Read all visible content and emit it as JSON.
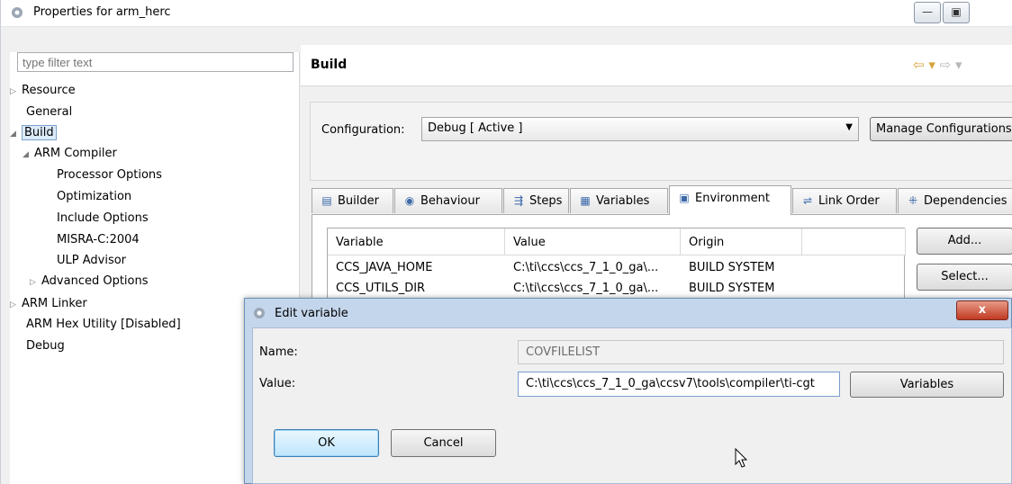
{
  "window": {
    "title": "Properties for arm_herc",
    "minimize_glyph": "—",
    "maximize_glyph": "▣"
  },
  "left": {
    "filter_placeholder": "type filter text",
    "tree": [
      {
        "label": "Resource",
        "arrow": "▷"
      },
      {
        "label": "General",
        "arrow": ""
      },
      {
        "label": "Build",
        "arrow": "◢",
        "selected": true
      },
      {
        "label": "ARM Compiler",
        "arrow": "◢"
      },
      {
        "label": "Processor Options",
        "arrow": ""
      },
      {
        "label": "Optimization",
        "arrow": ""
      },
      {
        "label": "Include Options",
        "arrow": ""
      },
      {
        "label": "MISRA-C:2004",
        "arrow": ""
      },
      {
        "label": "ULP Advisor",
        "arrow": ""
      },
      {
        "label": "Advanced Options",
        "arrow": "▷"
      },
      {
        "label": "ARM Linker",
        "arrow": "▷"
      },
      {
        "label": "ARM Hex Utility  [Disabled]",
        "arrow": ""
      },
      {
        "label": "Debug",
        "arrow": ""
      }
    ]
  },
  "build": {
    "heading": "Build",
    "nav_back": "⇦ ▾",
    "nav_forward": "⇨ ▾",
    "config_label": "Configuration:",
    "config_value": "Debug  [ Active ]",
    "manage_button": "Manage Configurations...",
    "tabs": [
      {
        "label": "Builder",
        "icon": "▤"
      },
      {
        "label": "Behaviour",
        "icon": "◉"
      },
      {
        "label": "Steps",
        "icon": "⇶"
      },
      {
        "label": "Variables",
        "icon": "▦"
      },
      {
        "label": "Environment",
        "icon": "▣",
        "active": true
      },
      {
        "label": "Link Order",
        "icon": "⇌"
      },
      {
        "label": "Dependencies",
        "icon": "⁜"
      }
    ],
    "table": {
      "headers": [
        "Variable",
        "Value",
        "Origin"
      ],
      "rows": [
        [
          "CCS_JAVA_HOME",
          "C:\\ti\\ccs\\ccs_7_1_0_ga\\...",
          "BUILD SYSTEM"
        ],
        [
          "CCS_UTILS_DIR",
          "C:\\ti\\ccs\\ccs_7_1_0_ga\\...",
          "BUILD SYSTEM"
        ]
      ]
    },
    "add_button": "Add...",
    "select_button": "Select..."
  },
  "dialog": {
    "title": "Edit variable",
    "close_glyph": "x",
    "name_label": "Name:",
    "name_value": "COVFILELIST",
    "value_label": "Value:",
    "value_value": "C:\\ti\\ccs\\ccs_7_1_0_ga\\ccsv7\\tools\\compiler\\ti-cgt",
    "variables_button": "Variables",
    "ok_button": "OK",
    "cancel_button": "Cancel"
  },
  "colors": {
    "dialog_frame": "#c4d6ec",
    "close_button": "#c13a23",
    "ok_button": "#bee6fd",
    "nav_arrow": "#d7a43a"
  }
}
